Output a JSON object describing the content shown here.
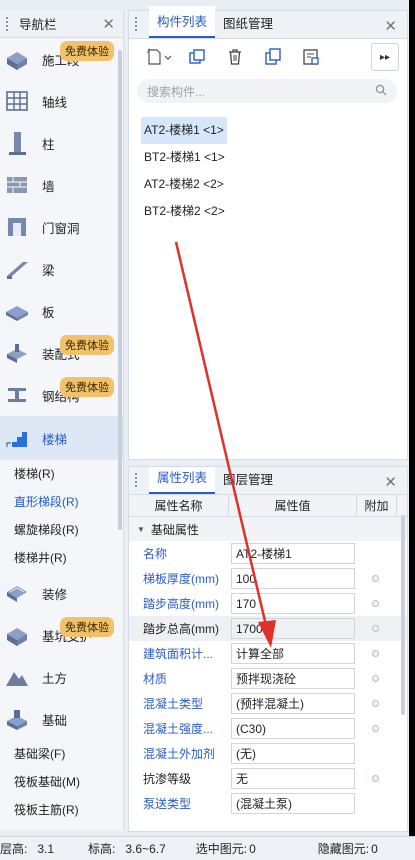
{
  "nav": {
    "title": "导航栏",
    "badge_label": "免费体验",
    "items": [
      {
        "label": "施工段",
        "icon": "construction-section-icon",
        "badge": true
      },
      {
        "label": "轴线",
        "icon": "axis-grid-icon",
        "badge": false
      },
      {
        "label": "柱",
        "icon": "column-icon",
        "badge": false
      },
      {
        "label": "墙",
        "icon": "wall-icon",
        "badge": false
      },
      {
        "label": "门窗洞",
        "icon": "door-window-icon",
        "badge": false
      },
      {
        "label": "梁",
        "icon": "beam-icon",
        "badge": false
      },
      {
        "label": "板",
        "icon": "slab-icon",
        "badge": false
      },
      {
        "label": "装配式",
        "icon": "prefab-icon",
        "badge": true
      },
      {
        "label": "钢结构",
        "icon": "steel-icon",
        "badge": true
      },
      {
        "label": "楼梯",
        "icon": "stair-icon",
        "badge": false,
        "active": true
      }
    ],
    "stair_sub": [
      "楼梯(R)",
      "直形梯段(R)",
      "螺旋梯段(R)",
      "楼梯井(R)"
    ],
    "items2": [
      {
        "label": "装修",
        "icon": "decoration-icon",
        "badge": false
      },
      {
        "label": "基坑支护",
        "icon": "foundation-pit-icon",
        "badge": true
      },
      {
        "label": "土方",
        "icon": "earthwork-icon",
        "badge": false
      },
      {
        "label": "基础",
        "icon": "foundation-icon",
        "badge": false
      }
    ],
    "foundation_sub": [
      "基础梁(F)",
      "筏板基础(M)",
      "筏板主筋(R)"
    ]
  },
  "components": {
    "tab_active": "构件列表",
    "tab_other": "图纸管理",
    "search_placeholder": "搜索构件...",
    "items": [
      "AT2-楼梯1 <1>",
      "BT2-楼梯1 <1>",
      "AT2-楼梯2 <2>",
      "BT2-楼梯2 <2>"
    ],
    "selected_index": 0
  },
  "properties": {
    "tab_active": "属性列表",
    "tab_other": "图层管理",
    "col_name": "属性名称",
    "col_value": "属性值",
    "col_extra": "附加",
    "group": "基础属性",
    "rows": [
      {
        "name": "名称",
        "value": "AT2-楼梯1",
        "blue": true,
        "dot": false
      },
      {
        "name": "梯板厚度(mm)",
        "value": "100",
        "blue": true,
        "dot": true
      },
      {
        "name": "踏步高度(mm)",
        "value": "170",
        "blue": true,
        "dot": true
      },
      {
        "name": "踏步总高(mm)",
        "value": "1700",
        "blue": false,
        "dot": true,
        "gray": true
      },
      {
        "name": "建筑面积计...",
        "value": "计算全部",
        "blue": true,
        "dot": true
      },
      {
        "name": "材质",
        "value": "预拌现浇砼",
        "blue": true,
        "dot": true
      },
      {
        "name": "混凝土类型",
        "value": "(预拌混凝土)",
        "blue": true,
        "dot": true
      },
      {
        "name": "混凝土强度...",
        "value": "(C30)",
        "blue": true,
        "dot": true
      },
      {
        "name": "混凝土外加剂",
        "value": "(无)",
        "blue": true,
        "dot": false
      },
      {
        "name": "抗渗等级",
        "value": "无",
        "blue": false,
        "dot": true
      },
      {
        "name": "泵送类型",
        "value": "(混凝土泵)",
        "blue": true,
        "dot": false
      }
    ]
  },
  "status": {
    "floor_label": "层高:",
    "floor_value": "3.1",
    "elev_label": "标高:",
    "elev_value": "3.6~6.7",
    "selected_label": "选中图元:",
    "selected_value": "0",
    "hidden_label": "隐藏图元:",
    "hidden_value": "0"
  },
  "colors": {
    "accent": "#2a5cc7",
    "badge": "#f2c16b",
    "arrow": "#e0302a"
  }
}
